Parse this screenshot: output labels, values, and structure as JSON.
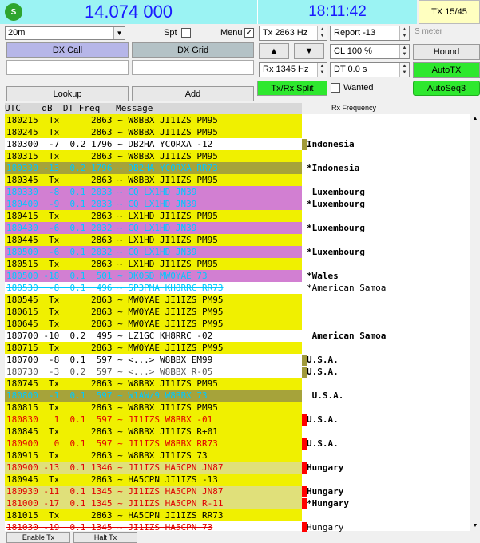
{
  "header": {
    "status_icon": "S",
    "frequency": "14.074 000",
    "clock": "18:11:42",
    "tx_indicator": "TX 15/45"
  },
  "controls": {
    "band": "20m",
    "spt_label": "Spt",
    "menu_label": "Menu",
    "menu_checked": "✓",
    "dx_call_label": "DX Call",
    "dx_grid_label": "DX Grid",
    "lookup_label": "Lookup",
    "add_label": "Add",
    "tx_spin": "Tx  2863  Hz",
    "report_spin": "Report -13",
    "s_meter_label": "S meter",
    "up_label": "▲",
    "down_label": "▼",
    "cl_spin": "CL  100 %",
    "hound_label": "Hound",
    "rx_spin": "Rx  1345  Hz",
    "dt_spin": "DT 0.0 s",
    "autotx_label": "AutoTX",
    "split_label": "Tx/Rx Split",
    "wanted_label": "Wanted",
    "autoseq_label": "AutoSeq3",
    "rx_frequency_label": "Rx Frequency"
  },
  "colors": {
    "tx_yellow": "#f0f000",
    "cq_purple": "#d27fd2",
    "mine_olive": "#a6a33a",
    "hungary_tan": "#e0e07a",
    "text_cyan": "#00c8ff",
    "text_red": "#e00000",
    "text_blue": "#0050ff",
    "marker_red": "#ff0000",
    "marker_olive": "#a09a3a"
  },
  "decode_header": "UTC    dB  DT Freq   Message",
  "decodes": [
    {
      "text": "180215  Tx      2863 ~ W8BBX JI1IZS PM95",
      "bg": "#f0f000",
      "fg": "#000000",
      "strike": false,
      "country": "",
      "cmark": ""
    },
    {
      "text": "180245  Tx      2863 ~ W8BBX JI1IZS PM95",
      "bg": "#f0f000",
      "fg": "#000000",
      "strike": false,
      "country": "",
      "cmark": ""
    },
    {
      "text": "180300  -7  0.2 1796 ~ DB2HA YC0RXA -12",
      "bg": "#ffffff",
      "fg": "#000000",
      "strike": false,
      "country": "Indonesia",
      "cmark": "#a09a3a"
    },
    {
      "text": "180315  Tx      2863 ~ W8BBX JI1IZS PM95",
      "bg": "#f0f000",
      "fg": "#000000",
      "strike": false,
      "country": "",
      "cmark": ""
    },
    {
      "text": "180330 -13  0.2 1796 ~ DB2HA YC0RXA RR73",
      "bg": "#a6a33a",
      "fg": "#00c8ff",
      "strike": false,
      "country": "*Indonesia",
      "cmark": ""
    },
    {
      "text": "180345  Tx      2863 ~ W8BBX JI1IZS PM95",
      "bg": "#f0f000",
      "fg": "#000000",
      "strike": false,
      "country": "",
      "cmark": ""
    },
    {
      "text": "180330  -8  0.1 2033 ~ CQ LX1HD JN39",
      "bg": "#d27fd2",
      "fg": "#00c8ff",
      "strike": false,
      "country": " Luxembourg",
      "cmark": ""
    },
    {
      "text": "180400  -9  0.1 2033 ~ CQ LX1HD JN39",
      "bg": "#d27fd2",
      "fg": "#00c8ff",
      "strike": false,
      "country": "*Luxembourg",
      "cmark": ""
    },
    {
      "text": "180415  Tx      2863 ~ LX1HD JI1IZS PM95",
      "bg": "#f0f000",
      "fg": "#000000",
      "strike": false,
      "country": "",
      "cmark": ""
    },
    {
      "text": "180430  -6  0.1 2032 ~ CQ LX1HD JN39",
      "bg": "#d27fd2",
      "fg": "#00c8ff",
      "strike": false,
      "country": "*Luxembourg",
      "cmark": ""
    },
    {
      "text": "180445  Tx      2863 ~ LX1HD JI1IZS PM95",
      "bg": "#f0f000",
      "fg": "#000000",
      "strike": false,
      "country": "",
      "cmark": ""
    },
    {
      "text": "180500  -6  0.1 2032 ~ CQ LX1HD JN39",
      "bg": "#d27fd2",
      "fg": "#00c8ff",
      "strike": false,
      "country": "*Luxembourg",
      "cmark": ""
    },
    {
      "text": "180515  Tx      2863 ~ LX1HD JI1IZS PM95",
      "bg": "#f0f000",
      "fg": "#000000",
      "strike": false,
      "country": "",
      "cmark": ""
    },
    {
      "text": "180500 -18  0.1  501 ~ DK0SD MW0YAE 73",
      "bg": "#d27fd2",
      "fg": "#00c8ff",
      "strike": false,
      "country": "*Wales",
      "cmark": ""
    },
    {
      "text": "180530  -8  0.1  496 ~ SP3PMA KH8RRC RR73",
      "bg": "#ffffff",
      "fg": "#00c8ff",
      "strike": true,
      "country": "*American Samoa",
      "cmark": ""
    },
    {
      "text": "180545  Tx      2863 ~ MW0YAE JI1IZS PM95",
      "bg": "#f0f000",
      "fg": "#000000",
      "strike": false,
      "country": "",
      "cmark": ""
    },
    {
      "text": "180615  Tx      2863 ~ MW0YAE JI1IZS PM95",
      "bg": "#f0f000",
      "fg": "#000000",
      "strike": false,
      "country": "",
      "cmark": ""
    },
    {
      "text": "180645  Tx      2863 ~ MW0YAE JI1IZS PM95",
      "bg": "#f0f000",
      "fg": "#000000",
      "strike": false,
      "country": "",
      "cmark": ""
    },
    {
      "text": "180700 -10  0.2  495 ~ LZ1GC KH8RRC -02",
      "bg": "#ffffff",
      "fg": "#000000",
      "strike": false,
      "country": " American Samoa",
      "cmark": ""
    },
    {
      "text": "180715  Tx      2863 ~ MW0YAE JI1IZS PM95",
      "bg": "#f0f000",
      "fg": "#000000",
      "strike": false,
      "country": "",
      "cmark": ""
    },
    {
      "text": "180700  -8  0.1  597 ~ <...> W8BBX EM99",
      "bg": "#ffffff",
      "fg": "#000000",
      "strike": false,
      "country": "U.S.A.",
      "cmark": "#a09a3a"
    },
    {
      "text": "180730  -3  0.2  597 ~ <...> W8BBX R-05",
      "bg": "#ffffff",
      "fg": "#555555",
      "strike": false,
      "country": "U.S.A.",
      "cmark": "#a09a3a"
    },
    {
      "text": "180745  Tx      2863 ~ W8BBX JI1IZS PM95",
      "bg": "#f0f000",
      "fg": "#000000",
      "strike": false,
      "country": "",
      "cmark": ""
    },
    {
      "text": "180800  -1  0.1  597 ~ W1AW/9 W8BBX 73",
      "bg": "#a6a33a",
      "fg": "#00c8ff",
      "strike": false,
      "country": " U.S.A.",
      "cmark": ""
    },
    {
      "text": "180815  Tx      2863 ~ W8BBX JI1IZS PM95",
      "bg": "#f0f000",
      "fg": "#000000",
      "strike": false,
      "country": "",
      "cmark": ""
    },
    {
      "text": "180830   1  0.1  597 ~ JI1IZS W8BBX -01",
      "bg": "#f0f000",
      "fg": "#e00000",
      "strike": false,
      "country": "U.S.A.",
      "cmark": "#ff0000"
    },
    {
      "text": "180845  Tx      2863 ~ W8BBX JI1IZS R+01",
      "bg": "#f0f000",
      "fg": "#000000",
      "strike": false,
      "country": "",
      "cmark": ""
    },
    {
      "text": "180900   0  0.1  597 ~ JI1IZS W8BBX RR73",
      "bg": "#f0f000",
      "fg": "#e00000",
      "strike": false,
      "country": "U.S.A.",
      "cmark": "#ff0000"
    },
    {
      "text": "180915  Tx      2863 ~ W8BBX JI1IZS 73",
      "bg": "#f0f000",
      "fg": "#000000",
      "strike": false,
      "country": "",
      "cmark": ""
    },
    {
      "text": "180900 -13  0.1 1346 ~ JI1IZS HA5CPN JN87",
      "bg": "#e0e07a",
      "fg": "#e00000",
      "strike": false,
      "country": "Hungary",
      "cmark": "#ff0000"
    },
    {
      "text": "180945  Tx      2863 ~ HA5CPN JI1IZS -13",
      "bg": "#f0f000",
      "fg": "#000000",
      "strike": false,
      "country": "",
      "cmark": ""
    },
    {
      "text": "180930 -11  0.1 1345 ~ JI1IZS HA5CPN JN87",
      "bg": "#e0e07a",
      "fg": "#e00000",
      "strike": false,
      "country": "Hungary",
      "cmark": "#ff0000"
    },
    {
      "text": "181000 -17  0.1 1345 ~ JI1IZS HA5CPN R-11",
      "bg": "#e0e07a",
      "fg": "#e00000",
      "strike": false,
      "country": "*Hungary",
      "cmark": "#ff0000"
    },
    {
      "text": "181015  Tx      2863 ~ HA5CPN JI1IZS RR73",
      "bg": "#f0f000",
      "fg": "#000000",
      "strike": false,
      "country": "",
      "cmark": ""
    },
    {
      "text": "181030 -19  0.1 1345 ~ JI1IZS HA5CPN 73",
      "bg": "#ffffff",
      "fg": "#e00000",
      "strike": true,
      "country": "Hungary",
      "cmark": "#ff0000"
    }
  ],
  "bottom": {
    "enable_tx": "Enable Tx",
    "halt_tx": "Halt Tx"
  }
}
